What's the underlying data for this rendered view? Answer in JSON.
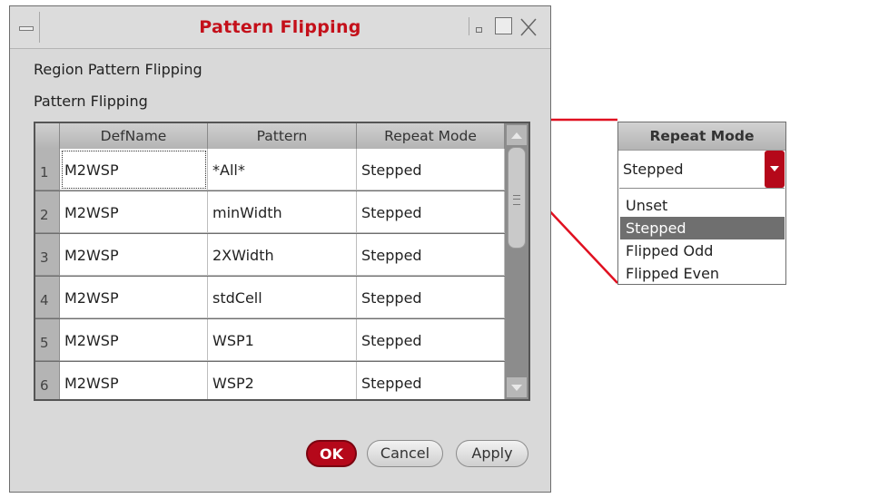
{
  "window": {
    "title": "Pattern Flipping"
  },
  "labels": {
    "region": "Region Pattern Flipping",
    "pattern": "Pattern Flipping"
  },
  "table": {
    "columns": [
      "DefName",
      "Pattern",
      "Repeat Mode"
    ],
    "rows": [
      {
        "num": "1",
        "defname": "M2WSP",
        "pattern": "*All*",
        "repeat": "Stepped"
      },
      {
        "num": "2",
        "defname": "M2WSP",
        "pattern": "minWidth",
        "repeat": "Stepped"
      },
      {
        "num": "3",
        "defname": "M2WSP",
        "pattern": "2XWidth",
        "repeat": "Stepped"
      },
      {
        "num": "4",
        "defname": "M2WSP",
        "pattern": "stdCell",
        "repeat": "Stepped"
      },
      {
        "num": "5",
        "defname": "M2WSP",
        "pattern": "WSP1",
        "repeat": "Stepped"
      },
      {
        "num": "6",
        "defname": "M2WSP",
        "pattern": "WSP2",
        "repeat": "Stepped"
      }
    ]
  },
  "buttons": {
    "ok": "OK",
    "cancel": "Cancel",
    "apply": "Apply"
  },
  "repeat_mode_popup": {
    "header": "Repeat Mode",
    "current_value": "Stepped",
    "options": [
      "Unset",
      "Stepped",
      "Flipped Odd",
      "Flipped Even"
    ],
    "selected": "Stepped"
  },
  "colors": {
    "accent": "#c4101a",
    "callout_line": "#e01020",
    "selected_option": "#6f6f6f"
  },
  "icons": {
    "window_menu": "window-menu-icon",
    "minimize": "minimize-icon",
    "maximize": "maximize-icon",
    "close": "close-icon",
    "dropdown": "chevron-down-icon"
  }
}
